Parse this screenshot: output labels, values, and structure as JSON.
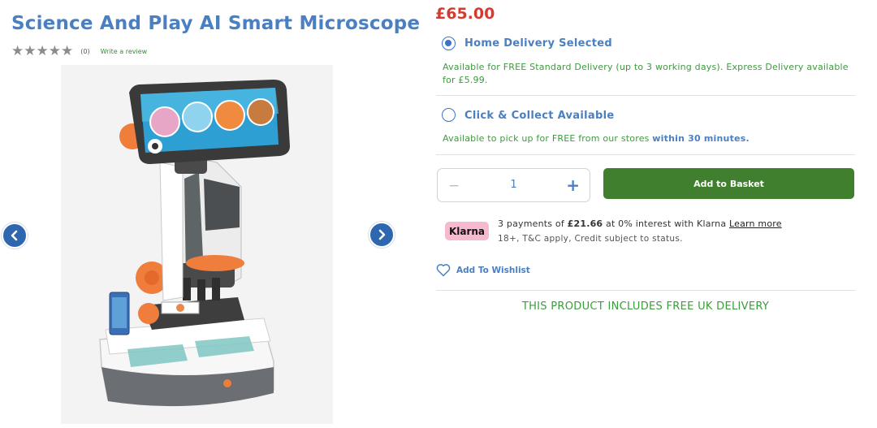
{
  "product": {
    "title": "Science And Play AI Smart Microscope",
    "rating_stars": 5,
    "rating_value": 0,
    "review_count": "(0)",
    "write_review_label": "Write a review"
  },
  "gallery": {
    "prev_icon": "chevron-left-icon",
    "next_icon": "chevron-right-icon",
    "image_alt": "AI smart microscope with smartphone holder"
  },
  "pricing": {
    "price": "£65.00"
  },
  "delivery": {
    "home": {
      "label": "Home Delivery Selected",
      "description": "Available for FREE Standard Delivery (up to 3 working days). Express Delivery available for £5.99.",
      "selected": true
    },
    "collect": {
      "label": "Click & Collect Available",
      "description_prefix": "Available to pick up for FREE from our stores",
      "description_emphasis": "within 30 minutes.",
      "selected": false
    }
  },
  "cart": {
    "minus": "−",
    "quantity": "1",
    "plus": "+",
    "add_label": "Add to Basket"
  },
  "klarna": {
    "logo_text": "Klarna",
    "line_prefix": "3 payments of",
    "amount": "£21.66",
    "line_suffix": "at 0% interest with Klarna",
    "learn_more": "Learn more",
    "terms": "18+, T&C apply, Credit subject to status."
  },
  "wishlist": {
    "label": "Add To Wishlist",
    "icon": "heart-icon"
  },
  "banner": {
    "free_delivery": "THIS PRODUCT INCLUDES FREE UK DELIVERY"
  },
  "colors": {
    "brand_blue": "#4a7fc1",
    "price_red": "#d63a2f",
    "success_green": "#3e9a3e",
    "basket_green": "#3f7f2d",
    "klarna_pink": "#f7b9d0",
    "arrow_blue": "#2f66b0"
  }
}
